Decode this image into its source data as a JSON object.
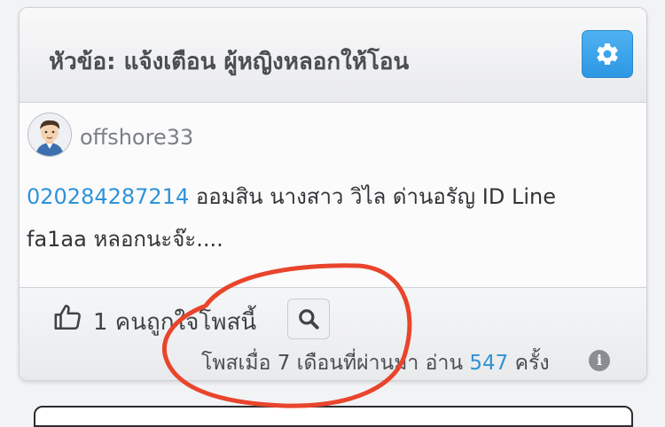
{
  "topic": {
    "title": "หัวข้อ: แจ้งเตือน ผู้หญิงหลอกให้โอน",
    "settings_icon": "gear-icon"
  },
  "post": {
    "username": "offshore33",
    "link_text": "020284287214",
    "line1_rest": " ออมสิน  นางสาว วิไล ด่านอรัญ  ID Line",
    "line2": "fa1aa  หลอกนะจ๊ะ...."
  },
  "footer": {
    "like_text": "1 คนถูกใจโพสนี้",
    "meta_prefix": "โพสเมื่อ 7 เดือนที่ผ่านมา อ่าน ",
    "read_count": "547",
    "meta_suffix": " ครั้ง",
    "info_glyph": "i"
  },
  "colors": {
    "accent_blue": "#2f93d8",
    "settings_button": "#3aa3ec",
    "annotation_red": "#e8452c"
  }
}
